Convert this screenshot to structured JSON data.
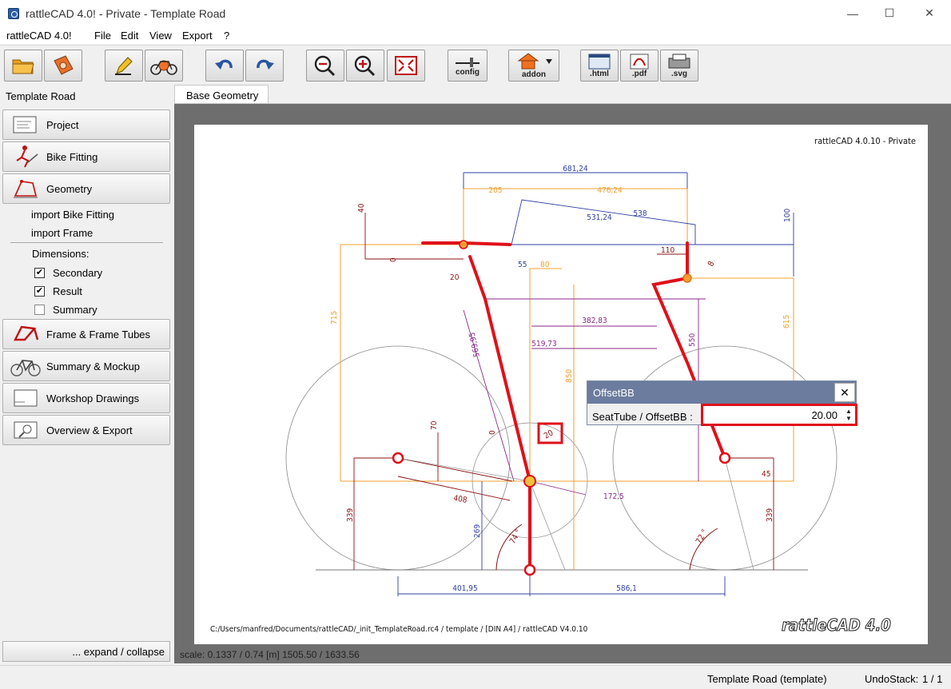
{
  "window": {
    "title": "rattleCAD 4.0!  - Private  - Template Road",
    "minimize_glyph": "—",
    "maximize_glyph": "☐",
    "close_glyph": "✕"
  },
  "menubar": {
    "app_name": "rattleCAD 4.0!",
    "items": [
      {
        "label": "File"
      },
      {
        "label": "Edit"
      },
      {
        "label": "View"
      },
      {
        "label": "Export"
      },
      {
        "label": "?"
      }
    ]
  },
  "toolbar": {
    "config_label": "config",
    "addon_label": "addon",
    "html_label": ".html",
    "pdf_label": ".pdf",
    "svg_label": ".svg"
  },
  "leftpanel": {
    "project_title": "Template Road",
    "nav": [
      {
        "label": "Project"
      },
      {
        "label": "Bike Fitting"
      },
      {
        "label": "Geometry"
      }
    ],
    "sub_links": [
      {
        "label": "import Bike Fitting"
      },
      {
        "label": "import Frame"
      }
    ],
    "dimensions_label": "Dimensions:",
    "checkboxes": [
      {
        "label": "Secondary",
        "checked": true,
        "mark": "✔"
      },
      {
        "label": "Result",
        "checked": true,
        "mark": "✔"
      },
      {
        "label": "Summary",
        "checked": false,
        "mark": ""
      }
    ],
    "nav2": [
      {
        "label": "Frame & Frame Tubes"
      },
      {
        "label": "Summary & Mockup"
      },
      {
        "label": "Workshop Drawings"
      },
      {
        "label": "Overview & Export"
      }
    ],
    "expand_label": "... expand / collapse"
  },
  "tab": {
    "label": "Base Geometry"
  },
  "sheet": {
    "header": "rattleCAD  4.0.10  -  Private",
    "footer_path": "C:/Users/manfred/Documents/rattleCAD/_init_TemplateRoad.rc4   /   template   /  [DIN A4]  /   rattleCAD   V4.0.10",
    "logo_text": "rattleCAD 4.0",
    "dims": {
      "d681": "681,24",
      "d205": "205",
      "d476": "476,24",
      "d531": "531,24",
      "d538": "538",
      "d40": "40",
      "d100": "100",
      "d0a": "0",
      "d55": "55",
      "d80": "80",
      "d110": "110",
      "d8": "8",
      "d20a": "20",
      "d715": "715",
      "d615": "615",
      "d382": "382,83",
      "d519": "519,73",
      "d550": "550",
      "d850": "850",
      "d569": "569,95",
      "d70": "70",
      "d0b": "0",
      "d20b": "20",
      "d408": "408",
      "d172": "172,5",
      "d45": "45",
      "d339a": "339",
      "d339b": "339",
      "d269": "269",
      "d74": "74 °",
      "d72": "72 °",
      "d401": "401,95",
      "d586": "586,1"
    }
  },
  "scale_info": "scale: 0.1337 / 0.74  [m]  1505.50 / 1633.56",
  "dialog": {
    "title": "OffsetBB",
    "close_glyph": "✕",
    "label": "SeatTube / OffsetBB   :",
    "value": "20.00",
    "spin_up": "▲",
    "spin_down": "▼"
  },
  "statusbar": {
    "project": "Template Road (template)",
    "undo_label": "UndoStack:",
    "undo_value": "1  /  1"
  }
}
